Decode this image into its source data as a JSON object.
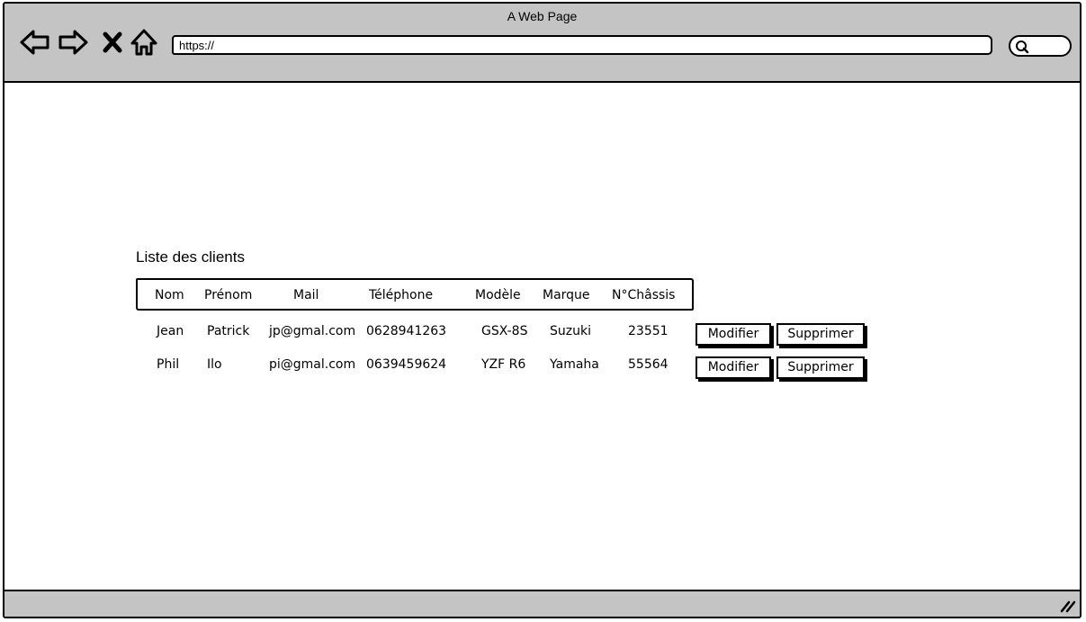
{
  "window": {
    "title": "A Web Page",
    "url": "https://"
  },
  "icons": [
    "back-arrow-icon",
    "forward-arrow-icon",
    "close-icon",
    "home-icon",
    "search-icon",
    "resize-grip-icon"
  ],
  "page": {
    "heading": "Liste des clients",
    "columns": [
      "Nom",
      "Prénom",
      "Mail",
      "Téléphone",
      "Modèle",
      "Marque",
      "N°Châssis"
    ],
    "rows": [
      {
        "nom": "Jean",
        "prenom": "Patrick",
        "mail": "jp@gmal.com",
        "telephone": "0628941263",
        "modele": "GSX-8S",
        "marque": "Suzuki",
        "chassis": "23551"
      },
      {
        "nom": "Phil",
        "prenom": "Ilo",
        "mail": "pi@gmal.com",
        "telephone": "0639459624",
        "modele": "YZF R6",
        "marque": "Yamaha",
        "chassis": "55564"
      }
    ],
    "actions": {
      "edit_label": "Modifier",
      "delete_label": "Supprimer"
    }
  },
  "colors": {
    "chrome": "#c4c4c4",
    "border": "#000000",
    "background": "#ffffff"
  }
}
